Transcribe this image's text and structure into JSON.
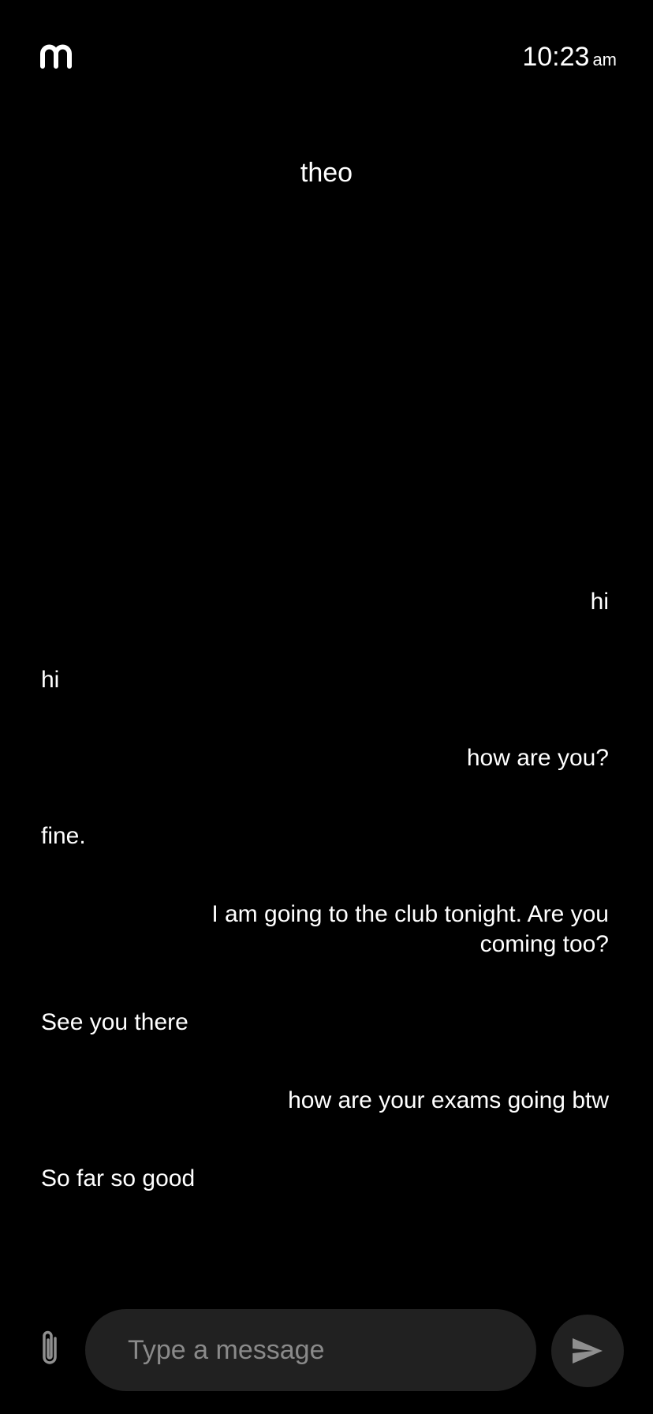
{
  "status": {
    "time": "10:23",
    "ampm": "am",
    "logo_icon": "m-logo-icon"
  },
  "conversation": {
    "contact_name": "theo",
    "messages": [
      {
        "direction": "sent",
        "text": "hi"
      },
      {
        "direction": "received",
        "text": "hi"
      },
      {
        "direction": "sent",
        "text": "how are you?"
      },
      {
        "direction": "received",
        "text": "fine."
      },
      {
        "direction": "sent",
        "text": "I am going to the club tonight. Are you coming too?"
      },
      {
        "direction": "received",
        "text": "See you there"
      },
      {
        "direction": "sent",
        "text": "how are your exams going btw"
      },
      {
        "direction": "received",
        "text": "So far so good"
      }
    ]
  },
  "composer": {
    "placeholder": "Type a message",
    "value": "",
    "attach_icon": "paperclip-icon",
    "send_icon": "send-icon"
  },
  "colors": {
    "background": "#000000",
    "text": "#ffffff",
    "input_background": "#212121",
    "placeholder": "#8a8a8a",
    "icon": "#8f8f8f"
  }
}
